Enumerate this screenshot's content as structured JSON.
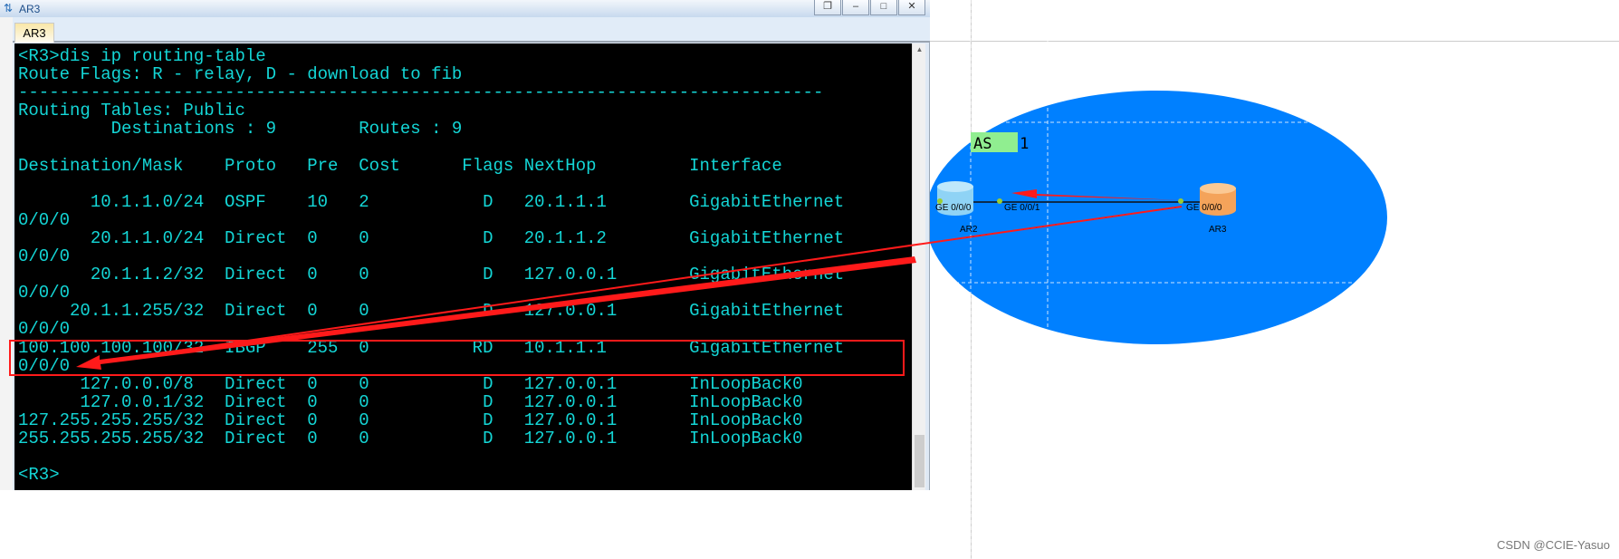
{
  "window": {
    "title": "AR3",
    "tab": "AR3",
    "buttons": [
      "restore",
      "minimize",
      "maximize",
      "close"
    ]
  },
  "terminal": {
    "lines": [
      "<R3>dis ip routing-table",
      "Route Flags: R - relay, D - download to fib",
      "------------------------------------------------------------------------------",
      "Routing Tables: Public",
      "         Destinations : 9        Routes : 9",
      "",
      "Destination/Mask    Proto   Pre  Cost      Flags NextHop         Interface",
      "",
      "       10.1.1.0/24  OSPF    10   2           D   20.1.1.1        GigabitEthernet",
      "0/0/0",
      "       20.1.1.0/24  Direct  0    0           D   20.1.1.2        GigabitEthernet",
      "0/0/0",
      "       20.1.1.2/32  Direct  0    0           D   127.0.0.1       GigabitEthernet",
      "0/0/0",
      "     20.1.1.255/32  Direct  0    0           D   127.0.0.1       GigabitEthernet",
      "0/0/0",
      "100.100.100.100/32  IBGP    255  0          RD   10.1.1.1        GigabitEthernet",
      "0/0/0",
      "      127.0.0.0/8   Direct  0    0           D   127.0.0.1       InLoopBack0",
      "      127.0.0.1/32  Direct  0    0           D   127.0.0.1       InLoopBack0",
      "127.255.255.255/32  Direct  0    0           D   127.0.0.1       InLoopBack0",
      "255.255.255.255/32  Direct  0    0           D   127.0.0.1       InLoopBack0",
      "",
      "<R3>"
    ]
  },
  "topology": {
    "as_label": "AS   1",
    "routers": [
      {
        "name": "AR2",
        "ports": [
          "GE 0/0/0",
          "GE 0/0/1"
        ]
      },
      {
        "name": "AR3",
        "ports": [
          "GE 0/0/0"
        ]
      }
    ],
    "colors": {
      "as_area": "#0080ff",
      "as_label_bg": "#90ee90",
      "annotation": "#ff1a1a"
    }
  },
  "watermark": "CSDN @CCIE-Yasuo"
}
